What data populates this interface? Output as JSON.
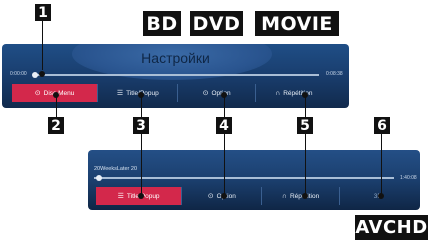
{
  "badges": {
    "bd": "BD",
    "dvd": "DVD",
    "movie": "MOVIE",
    "avchd": "AVCHD"
  },
  "callouts": [
    "1",
    "2",
    "3",
    "4",
    "5",
    "6"
  ],
  "screen1": {
    "title": "Настройки",
    "time_start": "0:00:00",
    "time_end": "0:08:38",
    "menu": [
      {
        "label": "Disc Menu",
        "icon": "disc-icon",
        "glyph": "⊙"
      },
      {
        "label": "Title/Popup",
        "icon": "list-icon",
        "glyph": "☰"
      },
      {
        "label": "Option",
        "icon": "option-icon",
        "glyph": "⊙"
      },
      {
        "label": "Répétition",
        "icon": "repeat-icon",
        "glyph": "∩"
      }
    ]
  },
  "screen2": {
    "file_name": "20WeeksLater 20",
    "time_end": "1:40:08",
    "menu": [
      {
        "label": "Title/Popup",
        "icon": "list-icon",
        "glyph": "☰"
      },
      {
        "label": "Option",
        "icon": "option-icon",
        "glyph": "⊙"
      },
      {
        "label": "Répétition",
        "icon": "repeat-icon",
        "glyph": "∩"
      },
      {
        "label": "3D",
        "icon": "3d-icon",
        "glyph": "3D"
      }
    ]
  },
  "colors": {
    "highlight": "#d3284b",
    "panel": "#1a3f70",
    "badge": "#111111"
  }
}
